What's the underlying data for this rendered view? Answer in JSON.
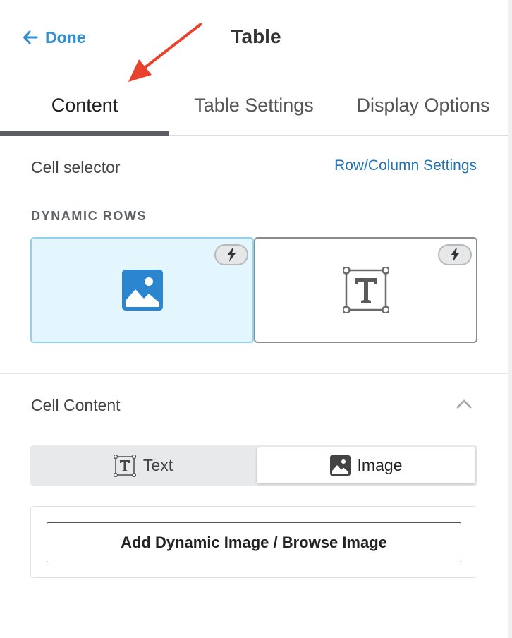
{
  "header": {
    "done_label": "Done",
    "title": "Table"
  },
  "tabs": [
    {
      "label": "Content",
      "active": true
    },
    {
      "label": "Table Settings",
      "active": false
    },
    {
      "label": "Display Options",
      "active": false
    }
  ],
  "cell_selector": {
    "label": "Cell selector",
    "link_label": "Row/Column Settings",
    "dynamic_rows_label": "DYNAMIC ROWS",
    "cells": [
      {
        "type": "image",
        "icon": "image-icon",
        "dynamic_badge": "lightning-icon",
        "selected": true
      },
      {
        "type": "text",
        "icon": "text-box-icon",
        "dynamic_badge": "lightning-icon",
        "selected": false
      }
    ]
  },
  "cell_content": {
    "label": "Cell Content",
    "toggle": [
      {
        "label": "Text",
        "icon": "text-box-icon",
        "selected": false
      },
      {
        "label": "Image",
        "icon": "image-icon",
        "selected": true
      }
    ],
    "browse_button_label": "Add Dynamic Image / Browse Image"
  },
  "colors": {
    "accent_blue": "#2f8fd0",
    "link_blue": "#2373b8",
    "selected_cell_bg": "#e3f5fd",
    "selected_cell_border": "#90d2ee",
    "annotation_arrow": "#e8412c"
  }
}
